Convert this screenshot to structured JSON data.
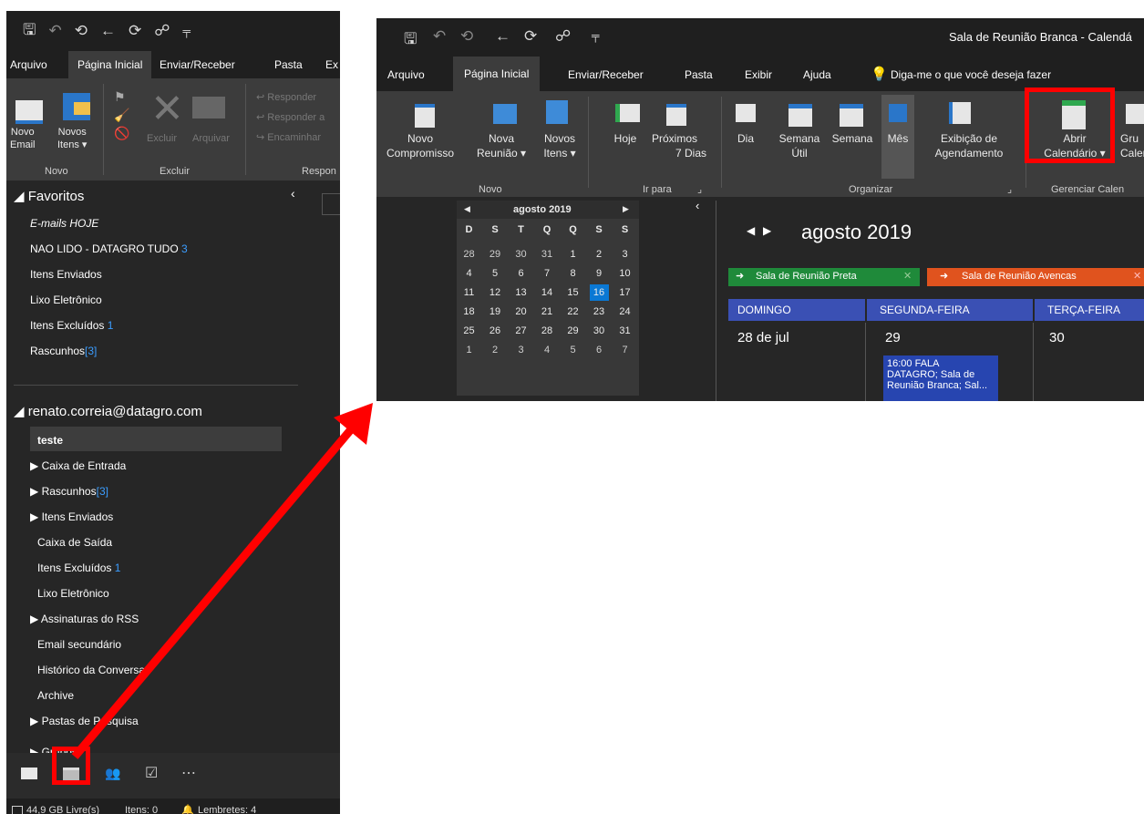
{
  "left": {
    "menu": [
      "Arquivo",
      "Página Inicial",
      "Enviar/Receber",
      "Pasta",
      "Ex"
    ],
    "ribbon": {
      "new_email": [
        "Novo",
        "Email"
      ],
      "new_items": [
        "Novos",
        "Itens ▾"
      ],
      "delete": "Excluir",
      "archive": "Arquivar",
      "reply": "Responder",
      "reply_all": "Responder a",
      "forward": "Encaminhar",
      "group_new": "Novo",
      "group_delete": "Excluir",
      "group_respond": "Respon"
    },
    "favorites_header": "◢ Favoritos",
    "favorites": [
      {
        "label": "E-mails HOJE",
        "badge": ""
      },
      {
        "label": "NAO LIDO - DATAGRO TUDO",
        "badge": "3"
      },
      {
        "label": "Itens Enviados",
        "badge": ""
      },
      {
        "label": "Lixo Eletrônico",
        "badge": ""
      },
      {
        "label": "Itens Excluídos",
        "badge": "1"
      },
      {
        "label": "Rascunhos",
        "badge": "[3]"
      }
    ],
    "account_header": "◢ renato.correia@datagro.com",
    "folders": [
      {
        "label": "teste",
        "badge": "",
        "prefix": ""
      },
      {
        "label": "Caixa de Entrada",
        "badge": "",
        "prefix": "▶ "
      },
      {
        "label": "Rascunhos",
        "badge": "[3]",
        "prefix": "▶ "
      },
      {
        "label": "Itens Enviados",
        "badge": "",
        "prefix": "▶ "
      },
      {
        "label": "Caixa de Saída",
        "badge": "",
        "prefix": ""
      },
      {
        "label": "Itens Excluídos",
        "badge": "1",
        "prefix": ""
      },
      {
        "label": "Lixo Eletrônico",
        "badge": "",
        "prefix": ""
      },
      {
        "label": "Assinaturas do RSS",
        "badge": "",
        "prefix": "▶ "
      },
      {
        "label": "Email secundário",
        "badge": "",
        "prefix": ""
      },
      {
        "label": "Histórico da Conversa",
        "badge": "",
        "prefix": ""
      },
      {
        "label": "Archive",
        "badge": "",
        "prefix": ""
      },
      {
        "label": "Pastas de Pesquisa",
        "badge": "",
        "prefix": "▶ "
      },
      {
        "label": "Grupos",
        "badge": "",
        "prefix": "▶ "
      }
    ],
    "status": {
      "free": "44,9 GB Livre(s)",
      "items": "Itens: 0",
      "reminders": "Lembretes: 4"
    }
  },
  "right": {
    "title": "Sala de Reunião Branca - Calendá",
    "menu": [
      "Arquivo",
      "Página Inicial",
      "Enviar/Receber",
      "Pasta",
      "Exibir",
      "Ajuda",
      "Diga-me o que você deseja fazer"
    ],
    "ribbon": {
      "novo_comp": [
        "Novo",
        "Compromisso"
      ],
      "nova_reuniao": [
        "Nova",
        "Reunião ▾"
      ],
      "novos_itens": [
        "Novos",
        "Itens ▾"
      ],
      "hoje": "Hoje",
      "proximos": [
        "Próximos",
        "7 Dias"
      ],
      "dia": "Dia",
      "semana_util": [
        "Semana",
        "Útil"
      ],
      "semana": "Semana",
      "mes": "Mês",
      "exibicao": [
        "Exibição de",
        "Agendamento"
      ],
      "abrir": [
        "Abrir",
        "Calendário ▾"
      ],
      "grupos": [
        "Gru",
        "Calen"
      ],
      "group_novo": "Novo",
      "group_irpara": "Ir para",
      "group_organizar": "Organizar",
      "group_gerenciar": "Gerenciar Calen"
    },
    "mini_cal": {
      "title": "agosto 2019",
      "days": [
        "D",
        "S",
        "T",
        "Q",
        "Q",
        "S",
        "S"
      ],
      "weeks": [
        [
          "28",
          "29",
          "30",
          "31",
          "1",
          "2",
          "3"
        ],
        [
          "4",
          "5",
          "6",
          "7",
          "8",
          "9",
          "10"
        ],
        [
          "11",
          "12",
          "13",
          "14",
          "15",
          "16",
          "17"
        ],
        [
          "18",
          "19",
          "20",
          "21",
          "22",
          "23",
          "24"
        ],
        [
          "25",
          "26",
          "27",
          "28",
          "29",
          "30",
          "31"
        ],
        [
          "1",
          "2",
          "3",
          "4",
          "5",
          "6",
          "7"
        ]
      ],
      "today": "16"
    },
    "main": {
      "month": "agosto 2019",
      "tab1": "Sala de Reunião Preta",
      "tab2": "Sala de Reunião Avencas",
      "days": [
        "DOMINGO",
        "SEGUNDA-FEIRA",
        "TERÇA-FEIRA"
      ],
      "dates": [
        "28 de jul",
        "29",
        "30"
      ],
      "appointment": [
        "16:00 FALA",
        "DATAGRO; Sala de",
        "Reunião Branca; Sal..."
      ]
    }
  },
  "colors": {
    "accent_red": "#ff0000",
    "today_blue": "#0a78d4",
    "day_header": "#3a50b4",
    "tab_green": "#1f8a3a",
    "tab_orange": "#e0531e"
  }
}
